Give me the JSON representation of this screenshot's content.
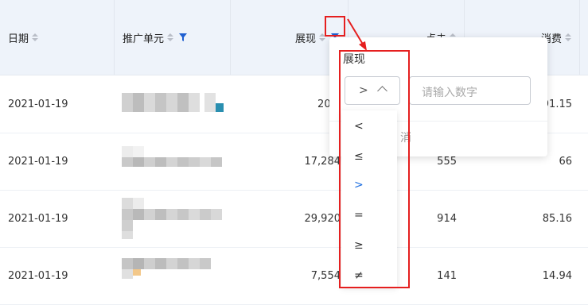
{
  "columns": [
    {
      "label": "日期"
    },
    {
      "label": "推广单元"
    },
    {
      "label": "展现"
    },
    {
      "label": "点击"
    },
    {
      "label": "消费"
    }
  ],
  "rows": [
    {
      "date": "2021-01-19",
      "impressions": "20,9",
      "clicks": "",
      "cost": "91.15"
    },
    {
      "date": "2021-01-19",
      "impressions": "17,284",
      "clicks": "555",
      "cost": "66"
    },
    {
      "date": "2021-01-19",
      "impressions": "29,920",
      "clicks": "914",
      "cost": "85.16"
    },
    {
      "date": "2021-01-19",
      "impressions": "7,554",
      "clicks": "141",
      "cost": "14.94"
    }
  ],
  "filter_popover": {
    "title": "展现",
    "operator_value": ">",
    "input_placeholder": "请输入数字",
    "cancel_label": "消"
  },
  "operator_options": [
    {
      "label": "<",
      "selected": false
    },
    {
      "label": "≤",
      "selected": false
    },
    {
      "label": ">",
      "selected": true
    },
    {
      "label": "=",
      "selected": false
    },
    {
      "label": "≥",
      "selected": false
    },
    {
      "label": "≠",
      "selected": false
    }
  ],
  "colors": {
    "accent": "#1f6fe0",
    "highlight": "#e51f1f",
    "header_bg": "#eef3fa"
  }
}
